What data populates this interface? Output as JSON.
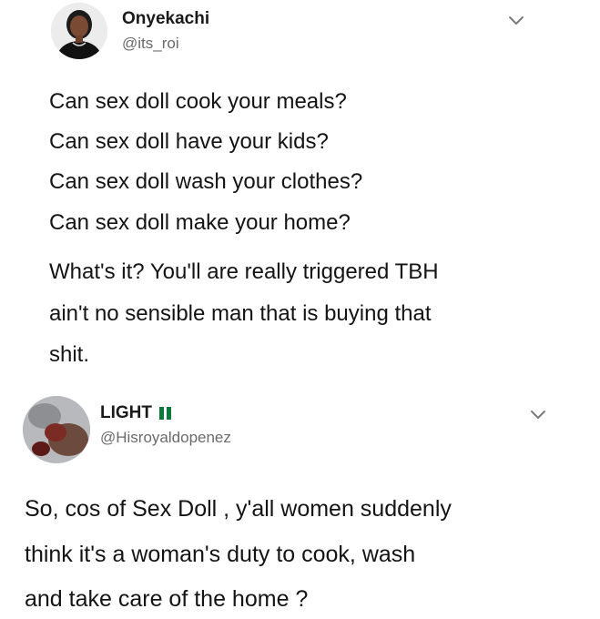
{
  "tweets": [
    {
      "display_name": "Onyekachi",
      "handle": "@its_roi",
      "lines": [
        "Can sex doll cook your meals?",
        "Can sex doll have your kids?",
        "Can sex doll wash your clothes?",
        "Can sex doll make your home?",
        "What's it? You'll are really triggered TBH",
        "ain't no sensible man that is buying that",
        "shit."
      ],
      "icons": {
        "more": "chevron-down-icon"
      }
    },
    {
      "display_name": "LIGHT",
      "handle": "@Hisroyaldopenez",
      "lines": [
        "So, cos of Sex Doll , y'all women suddenly",
        "think it's a woman's duty to cook, wash",
        "and take care of the home ?"
      ],
      "icons": {
        "flag": "nigeria-flag-icon",
        "more": "chevron-down-icon"
      },
      "colors": {
        "flag_green": "#0a7a3a"
      }
    }
  ]
}
